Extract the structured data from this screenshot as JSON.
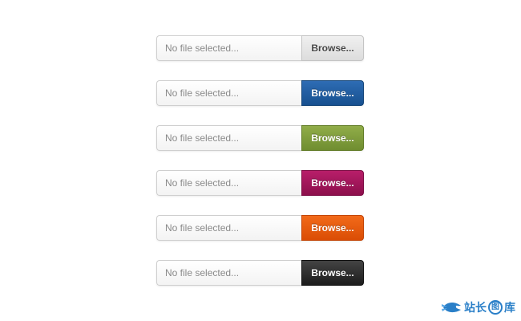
{
  "uploaders": [
    {
      "placeholder": "No file selected...",
      "button_label": "Browse...",
      "color": "#e4e4e4"
    },
    {
      "placeholder": "No file selected...",
      "button_label": "Browse...",
      "color": "#1f5fa3"
    },
    {
      "placeholder": "No file selected...",
      "button_label": "Browse...",
      "color": "#7f9b3c"
    },
    {
      "placeholder": "No file selected...",
      "button_label": "Browse...",
      "color": "#a3175b"
    },
    {
      "placeholder": "No file selected...",
      "button_label": "Browse...",
      "color": "#e75b0e"
    },
    {
      "placeholder": "No file selected...",
      "button_label": "Browse...",
      "color": "#2c2c2c"
    }
  ],
  "watermark": {
    "text": "站长",
    "circled_char": "图",
    "tail": "库",
    "icon": "fish-logo-icon",
    "color": "#2a7fc8"
  }
}
